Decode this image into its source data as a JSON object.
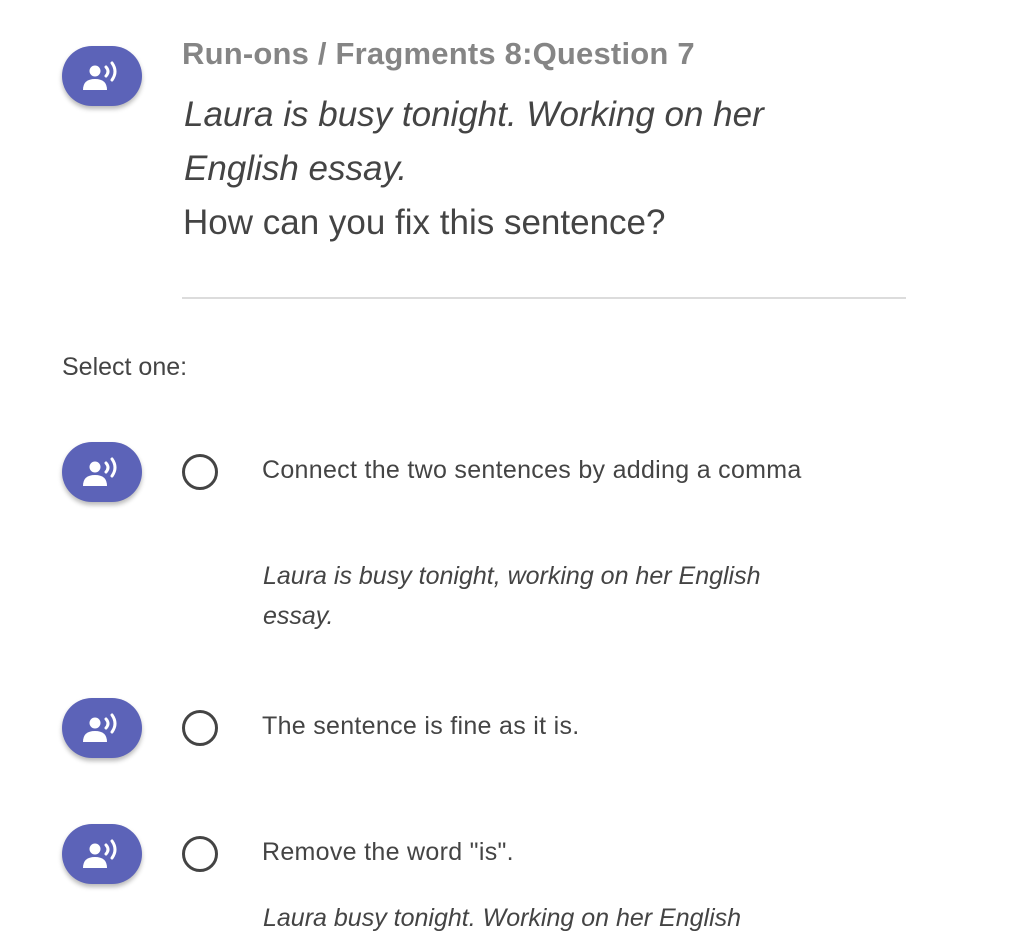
{
  "question": {
    "title": "Run-ons / Fragments 8:Question 7",
    "stem": "Laura is busy tonight. Working on her English essay.",
    "prompt": "How can you fix this sentence?"
  },
  "select_label": "Select one:",
  "speak_icon": "speaker-person-icon",
  "accent_color": "#5c63b8",
  "options": [
    {
      "label": "Connect the two sentences by adding a comma",
      "example": "Laura is busy tonight, working on her English essay."
    },
    {
      "label": "The sentence is fine as it is.",
      "example": ""
    },
    {
      "label": "Remove the word \"is\".",
      "example": "Laura busy tonight. Working on her English"
    }
  ]
}
